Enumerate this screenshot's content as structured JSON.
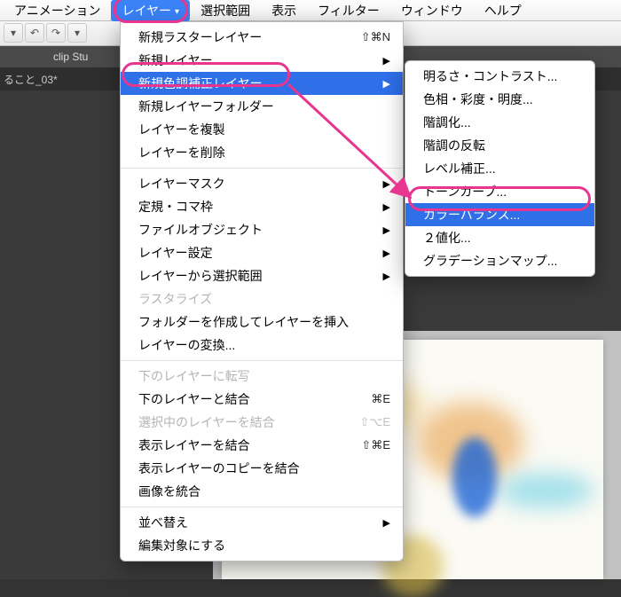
{
  "menubar": {
    "items": [
      {
        "label": "アニメーション",
        "name": "menu-animation"
      },
      {
        "label": "レイヤー",
        "name": "menu-layer",
        "selected": true
      },
      {
        "label": "選択範囲",
        "name": "menu-selection"
      },
      {
        "label": "表示",
        "name": "menu-view"
      },
      {
        "label": "フィルター",
        "name": "menu-filter"
      },
      {
        "label": "ウィンドウ",
        "name": "menu-window"
      },
      {
        "label": "ヘルプ",
        "name": "menu-help"
      }
    ]
  },
  "darkTop": "clip Stu",
  "tab": "ること_03*",
  "dropdown": {
    "items": [
      {
        "label": "新規ラスターレイヤー",
        "shortcut": "⇧⌘N"
      },
      {
        "label": "新規レイヤー",
        "submenu": true
      },
      {
        "label": "新規色調補正レイヤー",
        "submenu": true,
        "highlight": true
      },
      {
        "label": "新規レイヤーフォルダー"
      },
      {
        "label": "レイヤーを複製"
      },
      {
        "label": "レイヤーを削除"
      },
      {
        "sep": true
      },
      {
        "label": "レイヤーマスク",
        "submenu": true
      },
      {
        "label": "定規・コマ枠",
        "submenu": true
      },
      {
        "label": "ファイルオブジェクト",
        "submenu": true
      },
      {
        "label": "レイヤー設定",
        "submenu": true
      },
      {
        "label": "レイヤーから選択範囲",
        "submenu": true
      },
      {
        "label": "ラスタライズ",
        "disabled": true
      },
      {
        "label": "フォルダーを作成してレイヤーを挿入"
      },
      {
        "label": "レイヤーの変換..."
      },
      {
        "sep": true
      },
      {
        "label": "下のレイヤーに転写",
        "disabled": true
      },
      {
        "label": "下のレイヤーと結合",
        "shortcut": "⌘E"
      },
      {
        "label": "選択中のレイヤーを結合",
        "disabled": true,
        "shortcut": "⇧⌥E"
      },
      {
        "label": "表示レイヤーを結合",
        "shortcut": "⇧⌘E"
      },
      {
        "label": "表示レイヤーのコピーを結合"
      },
      {
        "label": "画像を統合"
      },
      {
        "sep": true
      },
      {
        "label": "並べ替え",
        "submenu": true
      },
      {
        "label": "編集対象にする"
      }
    ]
  },
  "submenu": {
    "items": [
      {
        "label": "明るさ・コントラスト..."
      },
      {
        "label": "色相・彩度・明度..."
      },
      {
        "label": "階調化..."
      },
      {
        "label": "階調の反転"
      },
      {
        "label": "レベル補正..."
      },
      {
        "label": "トーンカーブ..."
      },
      {
        "label": "カラーバランス...",
        "highlight": true
      },
      {
        "label": "２値化..."
      },
      {
        "label": "グラデーションマップ..."
      }
    ]
  }
}
